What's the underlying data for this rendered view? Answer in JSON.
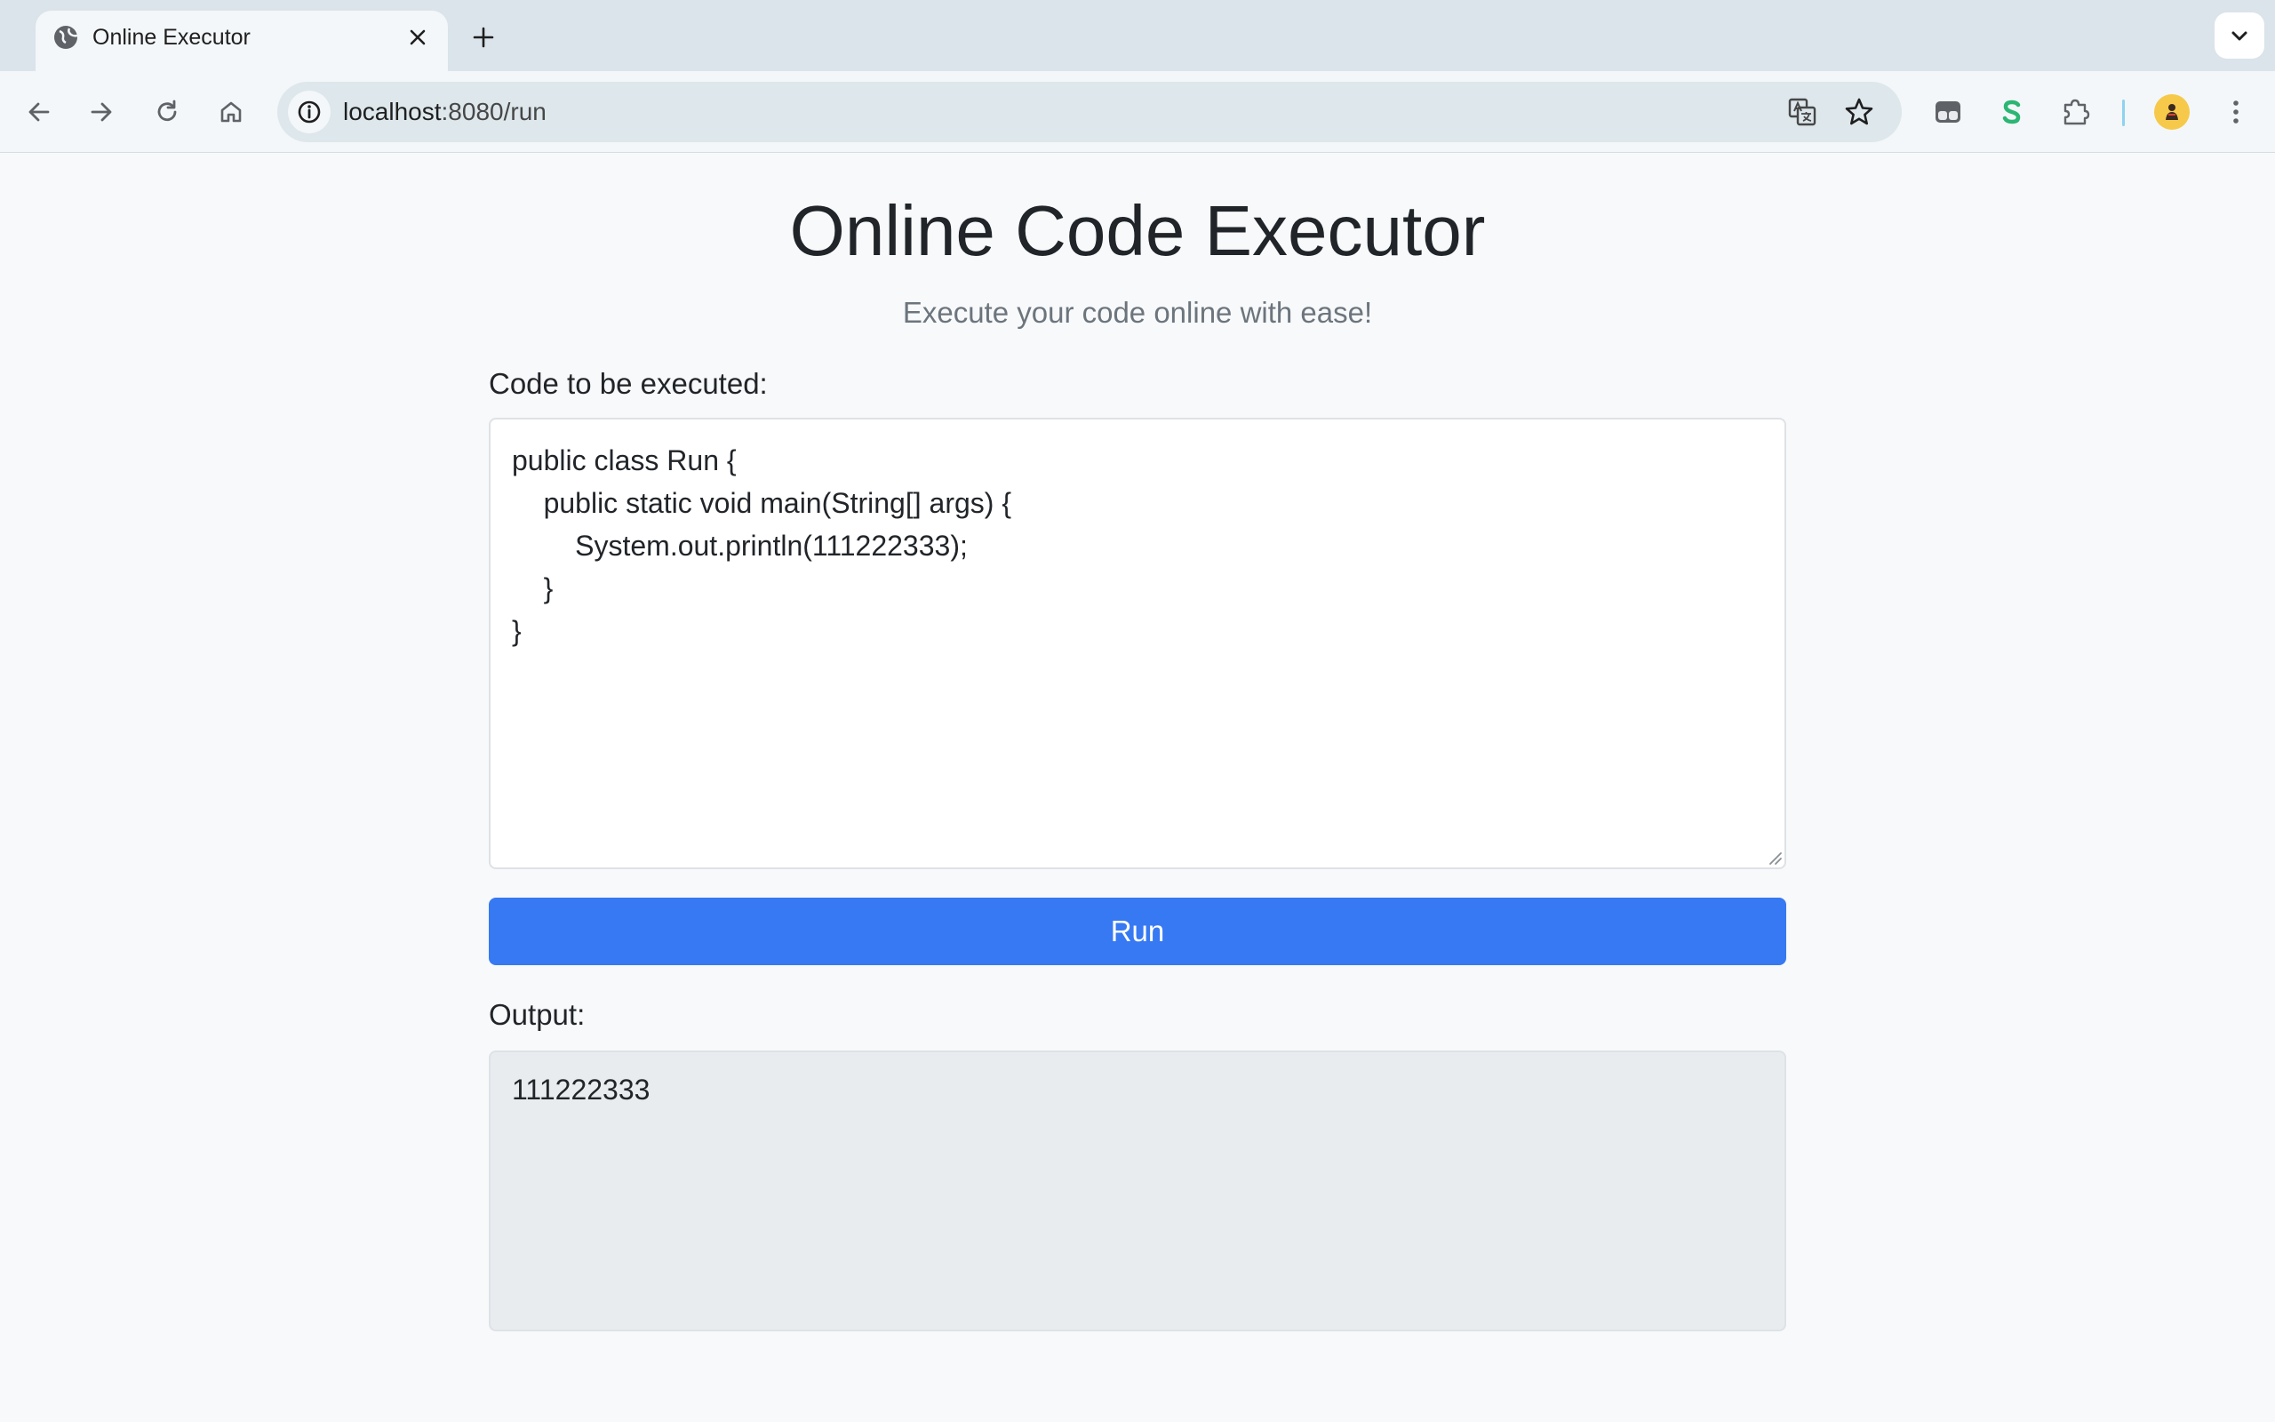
{
  "browser": {
    "tab": {
      "title": "Online Executor",
      "favicon": "globe-icon"
    },
    "url": {
      "host": "localhost",
      "rest": ":8080/run"
    },
    "icons": {
      "back": "arrow-left-icon",
      "forward": "arrow-right-icon",
      "reload": "reload-icon",
      "home": "home-icon",
      "site_info": "info-icon",
      "translate": "translate-icon",
      "bookmark": "star-icon",
      "extensions": "puzzle-icon",
      "menu": "kebab-menu-icon"
    }
  },
  "page": {
    "title": "Online Code Executor",
    "subtitle": "Execute your code online with ease!",
    "code_label": "Code to be executed:",
    "code": "public class Run {\n    public static void main(String[] args) {\n        System.out.println(111222333);\n    }\n}",
    "run_label": "Run",
    "output_label": "Output:",
    "output": "111222333"
  },
  "colors": {
    "primary": "#3779f2",
    "background": "#f8f9fa",
    "output_bg": "#e9ecef",
    "muted_text": "#6c757d"
  }
}
